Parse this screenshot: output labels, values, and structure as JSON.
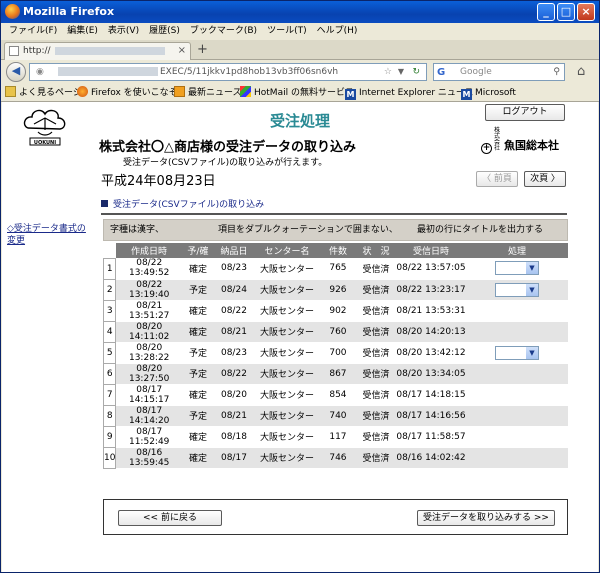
{
  "window": {
    "title": "Mozilla Firefox"
  },
  "menu": [
    "ファイル(F)",
    "編集(E)",
    "表示(V)",
    "履歴(S)",
    "ブックマーク(B)",
    "ツール(T)",
    "ヘルプ(H)"
  ],
  "tab": {
    "label": "http://",
    "close": "×",
    "new": "+"
  },
  "nav": {
    "url_visible": "EXEC/5/11jkkv1pd8hob13vb3ff06sn6vh",
    "search_placeholder": "Google"
  },
  "bookmarks": [
    "よく見るページ",
    "Firefox を使いこなそう",
    "最新ニュース",
    "HotMail の無料サービス",
    "Internet Explorer ニュース",
    "Microsoft"
  ],
  "page": {
    "heading": "受注処理",
    "logout": "ログアウト",
    "brand": "魚国総本社",
    "brand_prefix": "株式会社",
    "logo_text": "UOKUNI",
    "company_line": "株式会社〇△商店様の受注データの取り込み",
    "subdesc": "受注データ(CSVファイル)の取り込みが行えます。",
    "date": "平成24年08月23日",
    "prev_page": "〈 前頁",
    "next_page": "次頁 〉",
    "section": "受注データ(CSVファイル)の取り込み",
    "side_link": "◇受注データ書式の変更",
    "options": [
      "字種は漢字、",
      "項目をダブルクォーテーションで囲まない、",
      "最初の行にタイトルを出力する"
    ],
    "columns": [
      "作成日時",
      "予/確",
      "納品日",
      "センター名",
      "件数",
      "状　況",
      "受信日時",
      "処理"
    ],
    "rows": [
      {
        "no": "1",
        "created": "08/22 13:49:52",
        "type": "確定",
        "delivery": "08/23",
        "center": "大阪センター",
        "count": "765",
        "status": "受信済",
        "received": "08/22 13:57:05",
        "action": true
      },
      {
        "no": "2",
        "created": "08/22 13:19:40",
        "type": "予定",
        "delivery": "08/24",
        "center": "大阪センター",
        "count": "926",
        "status": "受信済",
        "received": "08/22 13:23:17",
        "action": true
      },
      {
        "no": "3",
        "created": "08/21 13:51:27",
        "type": "確定",
        "delivery": "08/22",
        "center": "大阪センター",
        "count": "902",
        "status": "受信済",
        "received": "08/21 13:53:31",
        "action": false
      },
      {
        "no": "4",
        "created": "08/20 14:11:02",
        "type": "確定",
        "delivery": "08/21",
        "center": "大阪センター",
        "count": "760",
        "status": "受信済",
        "received": "08/20 14:20:13",
        "action": false
      },
      {
        "no": "5",
        "created": "08/20 13:28:22",
        "type": "予定",
        "delivery": "08/23",
        "center": "大阪センター",
        "count": "700",
        "status": "受信済",
        "received": "08/20 13:42:12",
        "action": true
      },
      {
        "no": "6",
        "created": "08/20 13:27:50",
        "type": "予定",
        "delivery": "08/22",
        "center": "大阪センター",
        "count": "867",
        "status": "受信済",
        "received": "08/20 13:34:05",
        "action": false
      },
      {
        "no": "7",
        "created": "08/17 14:15:17",
        "type": "確定",
        "delivery": "08/20",
        "center": "大阪センター",
        "count": "854",
        "status": "受信済",
        "received": "08/17 14:18:15",
        "action": false
      },
      {
        "no": "8",
        "created": "08/17 14:14:20",
        "type": "予定",
        "delivery": "08/21",
        "center": "大阪センター",
        "count": "740",
        "status": "受信済",
        "received": "08/17 14:16:56",
        "action": false
      },
      {
        "no": "9",
        "created": "08/17 11:52:49",
        "type": "確定",
        "delivery": "08/18",
        "center": "大阪センター",
        "count": "117",
        "status": "受信済",
        "received": "08/17 11:58:57",
        "action": false
      },
      {
        "no": "10",
        "created": "08/16 13:59:45",
        "type": "確定",
        "delivery": "08/17",
        "center": "大阪センター",
        "count": "746",
        "status": "受信済",
        "received": "08/16 14:02:42",
        "action": false
      }
    ],
    "back": "<< 前に戻る",
    "import": "受注データを取り込みする >>"
  }
}
